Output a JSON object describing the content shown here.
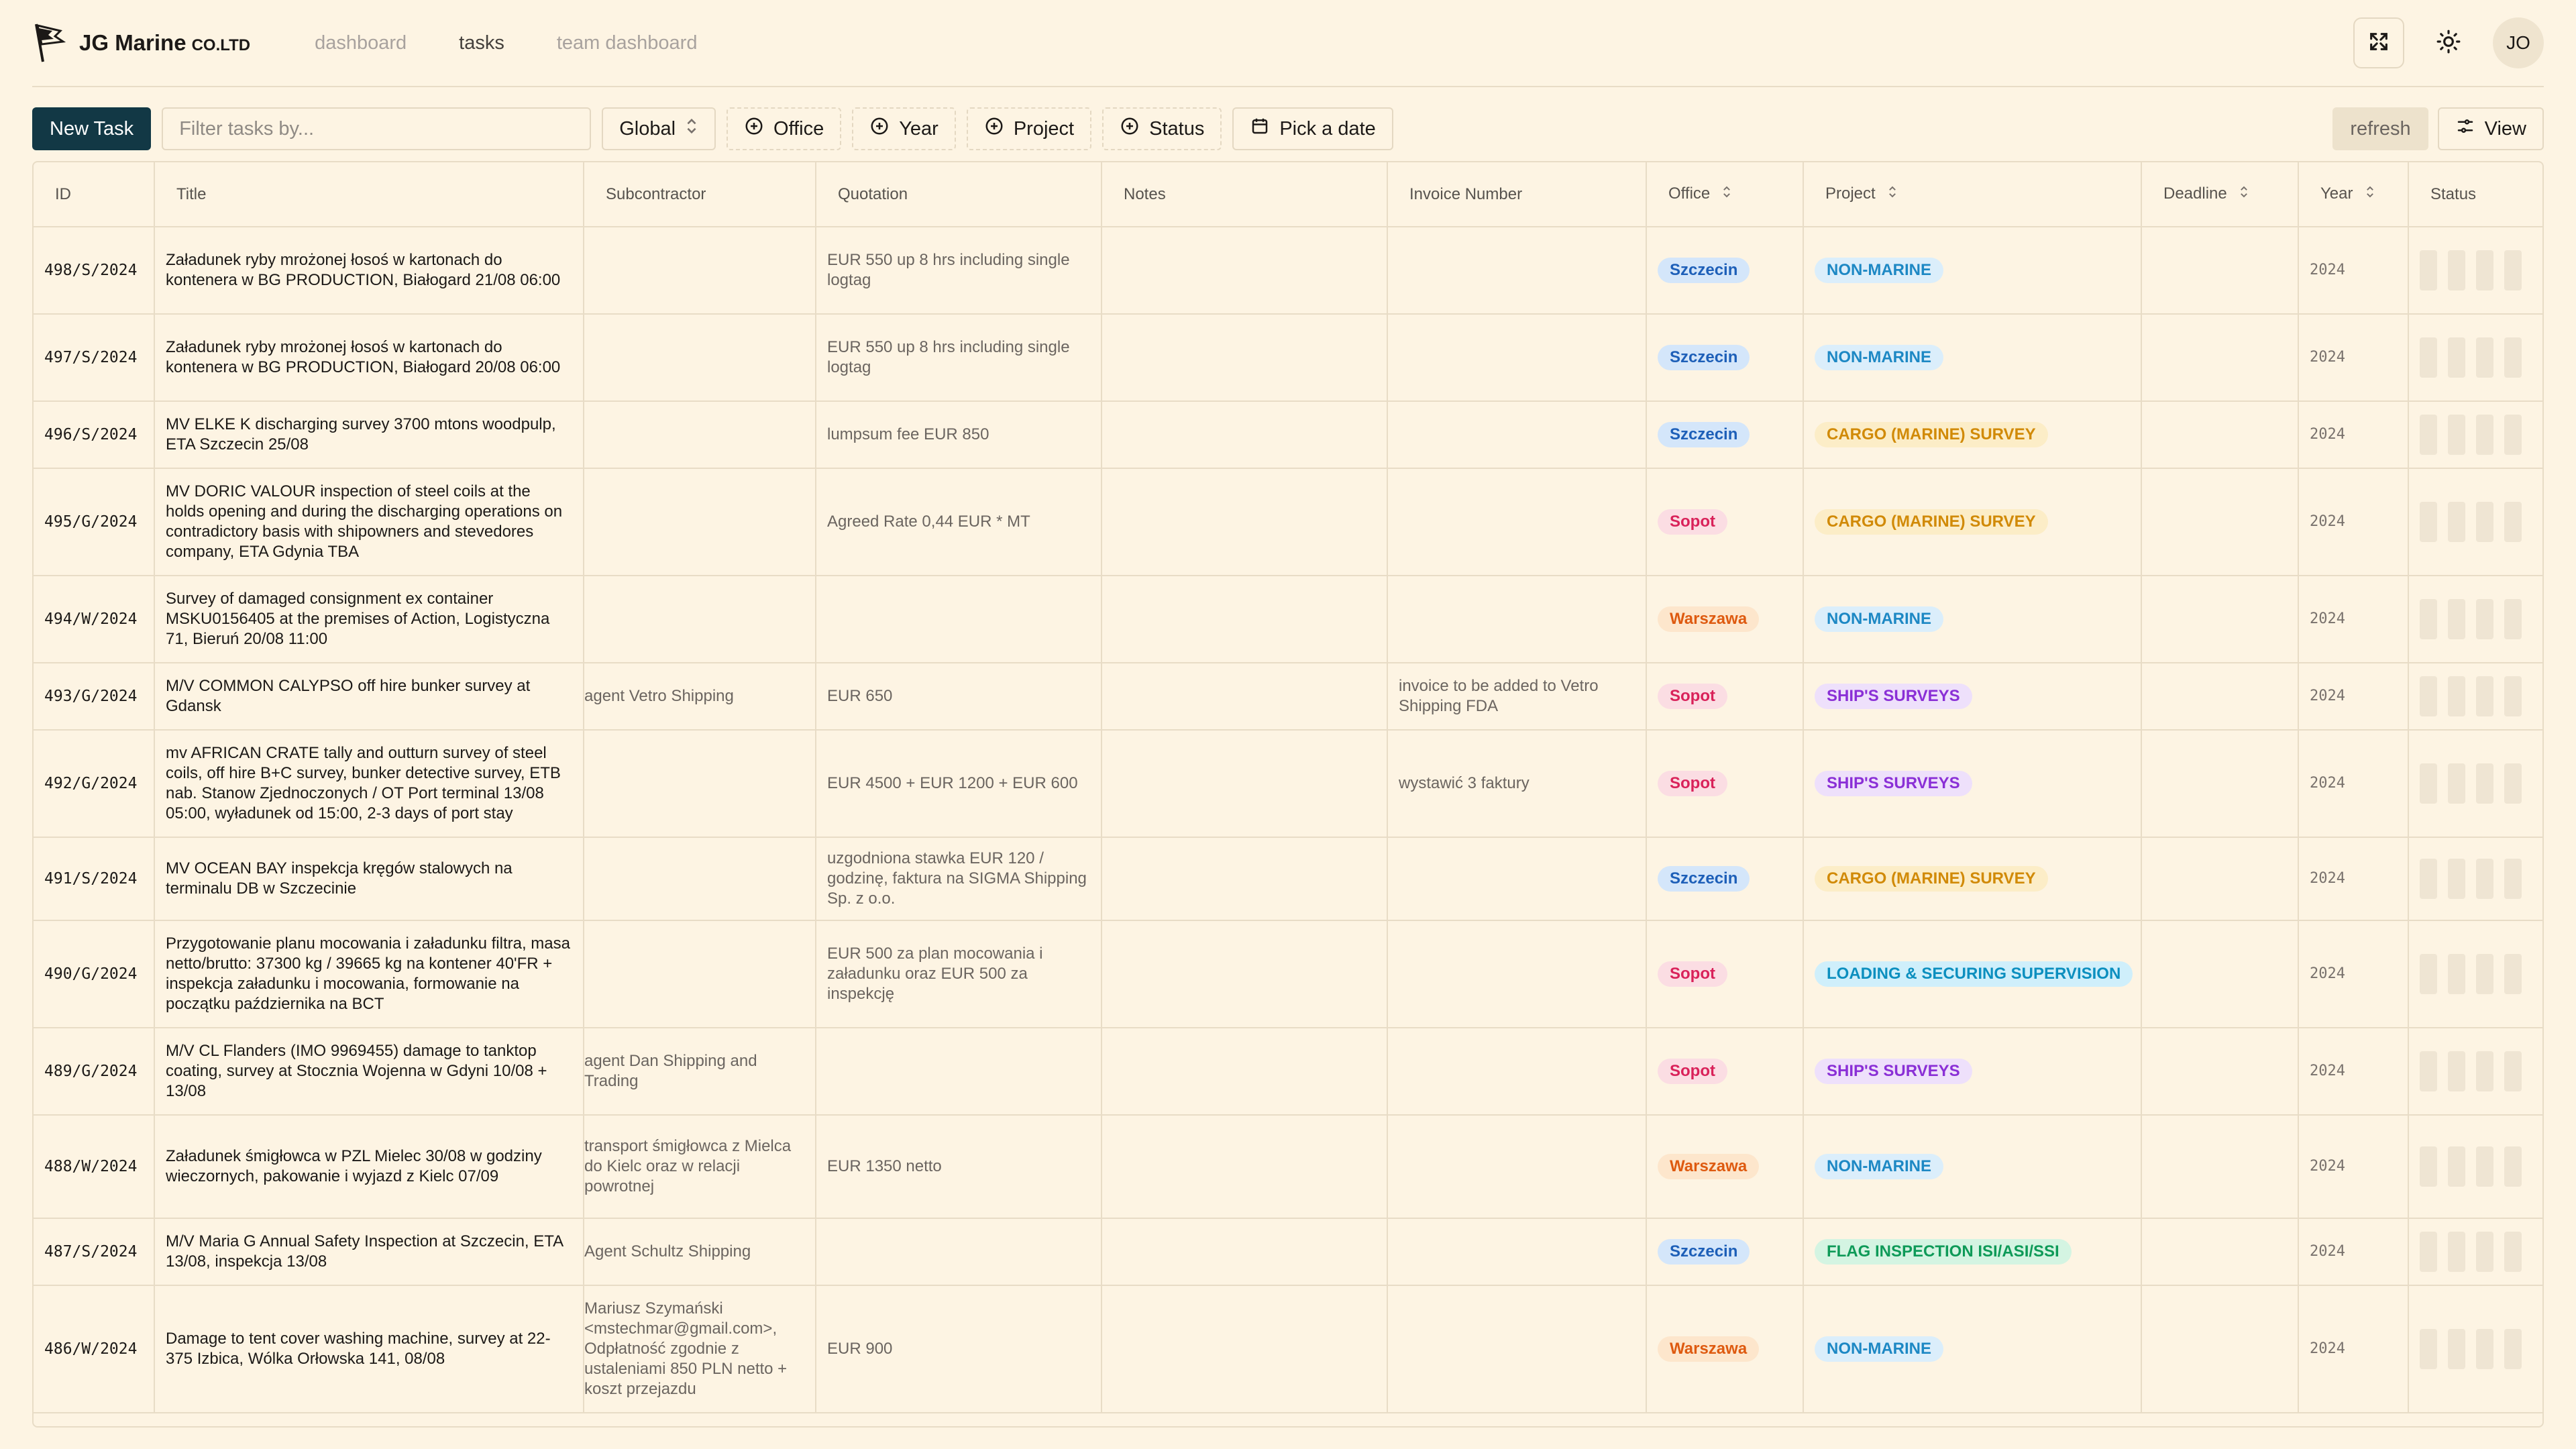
{
  "app": {
    "brand": "JG Marine",
    "brand_suffix": "CO.LTD"
  },
  "nav": [
    {
      "label": "dashboard",
      "active": false
    },
    {
      "label": "tasks",
      "active": true
    },
    {
      "label": "team dashboard",
      "active": false
    }
  ],
  "header_actions": {
    "avatar": "JO"
  },
  "toolbar": {
    "new_task": "New Task",
    "filter_placeholder": "Filter tasks by...",
    "scope": "Global",
    "office": "Office",
    "year": "Year",
    "project": "Project",
    "status": "Status",
    "date": "Pick a date",
    "refresh": "refresh",
    "view": "View"
  },
  "columns": [
    "ID",
    "Title",
    "Subcontractor",
    "Quotation",
    "Notes",
    "Invoice Number",
    "Office",
    "Project",
    "Deadline",
    "Year",
    "Status"
  ],
  "colors": {
    "office": {
      "Szczecin": {
        "bg": "#d4e6fa",
        "fg": "#1d5fb8"
      },
      "Sopot": {
        "bg": "#fbdde3",
        "fg": "#d9225a"
      },
      "Warszawa": {
        "bg": "#fde6cc",
        "fg": "#de5a10"
      }
    },
    "project": {
      "NON-MARINE": {
        "bg": "#dbeefb",
        "fg": "#1d88c4"
      },
      "CARGO (MARINE) SURVEY": {
        "bg": "#fcedc7",
        "fg": "#d18a07"
      },
      "SHIP'S SURVEYS": {
        "bg": "#eee0fb",
        "fg": "#8a2fd6"
      },
      "LOADING & SECURING SUPERVISION": {
        "bg": "#cfeffb",
        "fg": "#0c8fbf"
      },
      "FLAG INSPECTION ISI/ASI/SSI": {
        "bg": "#d4f4e2",
        "fg": "#0e9a58"
      }
    }
  },
  "rows": [
    {
      "id": "498/S/2024",
      "title": "Załadunek ryby mrożonej łosoś w kartonach do kontenera w BG PRODUCTION, Białogard 21/08 06:00",
      "sub": "",
      "quote": "EUR 550 up 8 hrs including single logtag",
      "notes": "",
      "invoice": "",
      "office": "Szczecin",
      "project": "NON-MARINE",
      "deadline": "",
      "year": "2024"
    },
    {
      "id": "497/S/2024",
      "title": "Załadunek ryby mrożonej łosoś w kartonach do kontenera w BG PRODUCTION, Białogard 20/08 06:00",
      "sub": "",
      "quote": "EUR 550 up 8 hrs including single logtag",
      "notes": "",
      "invoice": "",
      "office": "Szczecin",
      "project": "NON-MARINE",
      "deadline": "",
      "year": "2024"
    },
    {
      "id": "496/S/2024",
      "title": "MV ELKE K discharging survey 3700 mtons woodpulp, ETA Szczecin 25/08",
      "sub": "",
      "quote": "lumpsum fee EUR 850",
      "notes": "",
      "invoice": "",
      "office": "Szczecin",
      "project": "CARGO (MARINE) SURVEY",
      "deadline": "",
      "year": "2024"
    },
    {
      "id": "495/G/2024",
      "title": "MV DORIC VALOUR inspection of steel coils at the holds opening and during the discharging operations on contradictory basis with shipowners and stevedores company, ETA Gdynia TBA",
      "sub": "",
      "quote": "Agreed Rate 0,44 EUR * MT",
      "notes": "",
      "invoice": "",
      "office": "Sopot",
      "project": "CARGO (MARINE) SURVEY",
      "deadline": "",
      "year": "2024"
    },
    {
      "id": "494/W/2024",
      "title": "Survey of damaged consignment ex container MSKU0156405 at the premises of Action, Logistyczna 71, Bieruń 20/08 11:00",
      "sub": "",
      "quote": "",
      "notes": "",
      "invoice": "",
      "office": "Warszawa",
      "project": "NON-MARINE",
      "deadline": "",
      "year": "2024"
    },
    {
      "id": "493/G/2024",
      "title": "M/V COMMON CALYPSO off hire bunker survey at Gdansk",
      "sub": "agent Vetro Shipping",
      "quote": "EUR 650",
      "notes": "",
      "invoice": "invoice to be added to Vetro Shipping FDA",
      "office": "Sopot",
      "project": "SHIP'S SURVEYS",
      "deadline": "",
      "year": "2024"
    },
    {
      "id": "492/G/2024",
      "title": "mv AFRICAN CRATE tally and outturn survey of steel coils, off hire B+C survey, bunker detective survey, ETB nab. Stanow Zjednoczonych / OT Port terminal 13/08 05:00, wyładunek od 15:00, 2-3 days of port stay",
      "sub": "",
      "quote": "EUR 4500 + EUR 1200 + EUR 600",
      "notes": "",
      "invoice": "wystawić 3 faktury",
      "office": "Sopot",
      "project": "SHIP'S SURVEYS",
      "deadline": "",
      "year": "2024"
    },
    {
      "id": "491/S/2024",
      "title": "MV OCEAN BAY inspekcja kręgów stalowych na terminalu DB w Szczecinie",
      "sub": "",
      "quote": "uzgodniona stawka EUR 120 / godzinę, faktura na SIGMA Shipping Sp. z o.o.",
      "notes": "",
      "invoice": "",
      "office": "Szczecin",
      "project": "CARGO (MARINE) SURVEY",
      "deadline": "",
      "year": "2024"
    },
    {
      "id": "490/G/2024",
      "title": "Przygotowanie planu mocowania i załadunku filtra, masa netto/brutto: 37300 kg / 39665 kg na kontener 40'FR + inspekcja załadunku i mocowania, formowanie na początku października na BCT",
      "sub": "",
      "quote": "EUR 500 za plan mocowania i załadunku oraz EUR 500 za inspekcję",
      "notes": "",
      "invoice": "",
      "office": "Sopot",
      "project": "LOADING & SECURING SUPERVISION",
      "deadline": "",
      "year": "2024"
    },
    {
      "id": "489/G/2024",
      "title": "M/V CL Flanders (IMO 9969455) damage to tanktop coating, survey at Stocznia Wojenna w Gdyni 10/08 + 13/08",
      "sub": "agent Dan Shipping and Trading",
      "quote": "",
      "notes": "",
      "invoice": "",
      "office": "Sopot",
      "project": "SHIP'S SURVEYS",
      "deadline": "",
      "year": "2024"
    },
    {
      "id": "488/W/2024",
      "title": "Załadunek śmigłowca w PZL Mielec 30/08 w godziny wieczornych, pakowanie i wyjazd z Kielc 07/09",
      "sub": "transport śmigłowca z Mielca do Kielc oraz w relacji powrotnej",
      "quote": "EUR 1350 netto",
      "notes": "",
      "invoice": "",
      "office": "Warszawa",
      "project": "NON-MARINE",
      "deadline": "",
      "year": "2024"
    },
    {
      "id": "487/S/2024",
      "title": "M/V Maria G Annual Safety Inspection at Szczecin, ETA 13/08, inspekcja 13/08",
      "sub": "Agent Schultz Shipping",
      "quote": "",
      "notes": "",
      "invoice": "",
      "office": "Szczecin",
      "project": "FLAG INSPECTION ISI/ASI/SSI",
      "deadline": "",
      "year": "2024"
    },
    {
      "id": "486/W/2024",
      "title": "Damage to tent cover washing machine, survey at 22-375 Izbica, Wólka Orłowska 141, 08/08",
      "sub": "Mariusz Szymański <mstechmar@gmail.com>, Odpłatność zgodnie z ustaleniami 850 PLN netto + koszt przejazdu",
      "quote": "EUR 900",
      "notes": "",
      "invoice": "",
      "office": "Warszawa",
      "project": "NON-MARINE",
      "deadline": "",
      "year": "2024"
    }
  ]
}
